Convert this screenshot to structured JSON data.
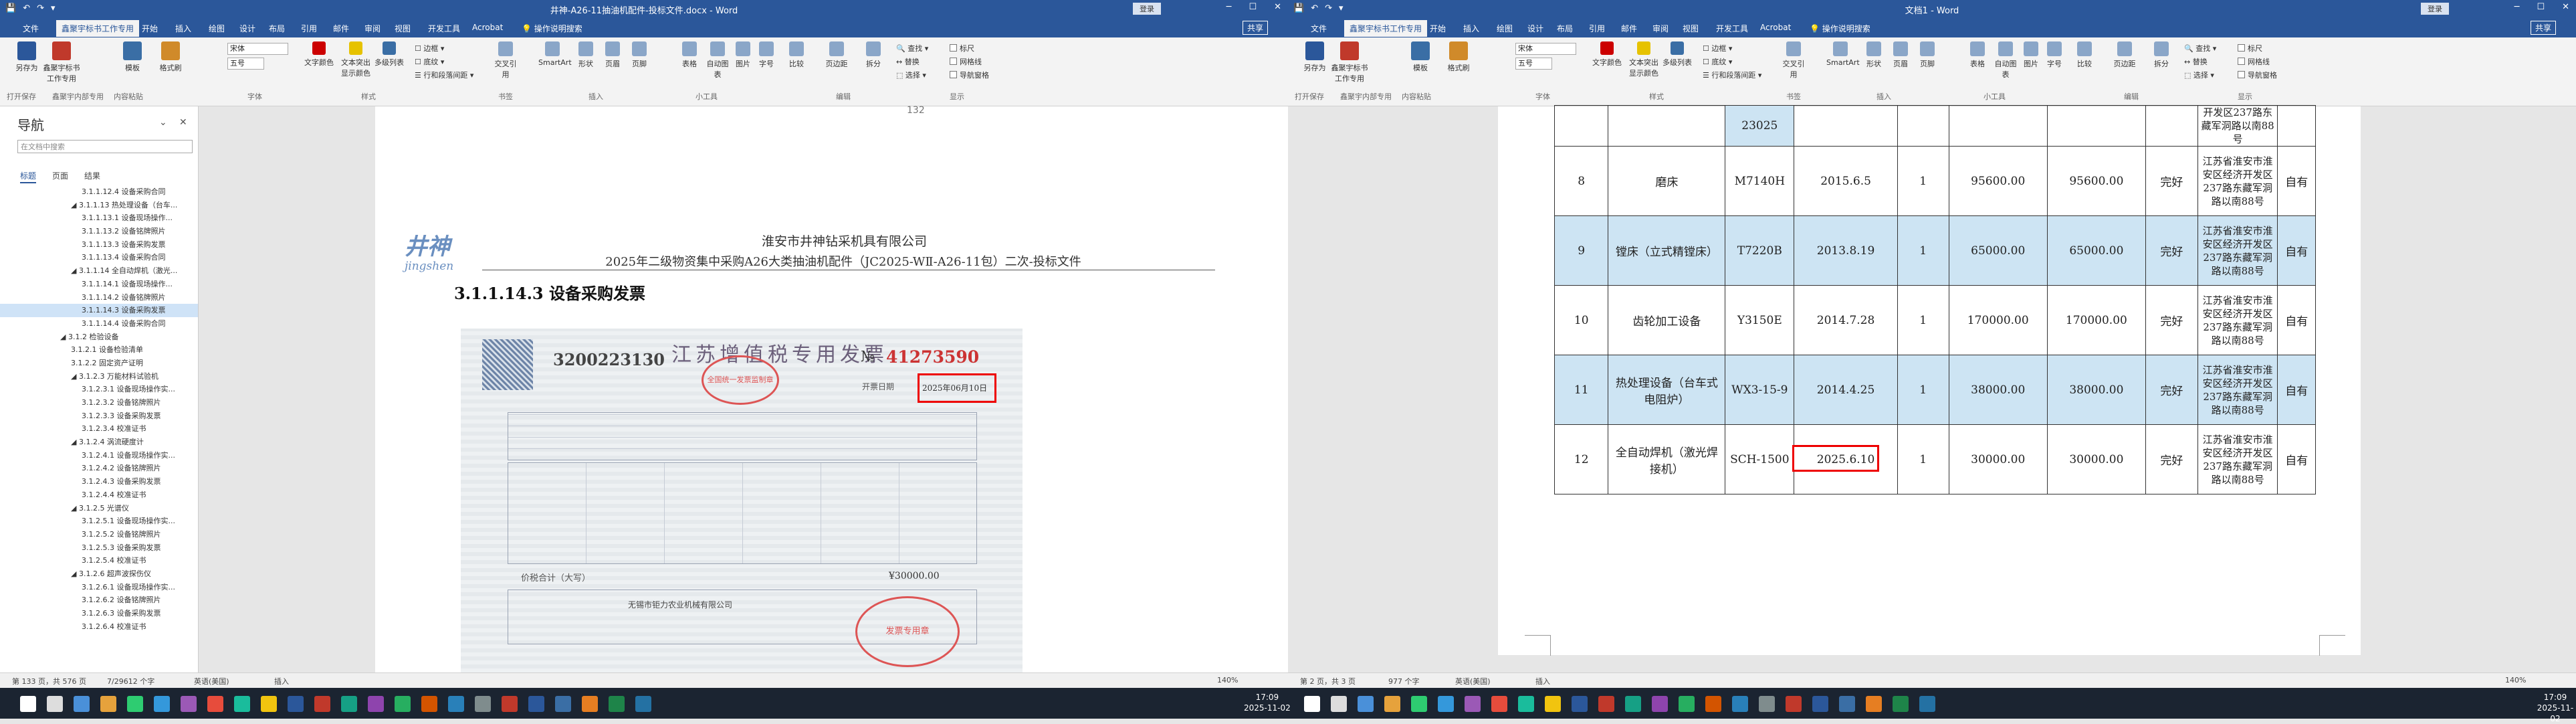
{
  "left_window": {
    "quick_access": [
      "💾",
      "↶",
      "↷",
      "▾"
    ],
    "title": "井神-A26-11抽油机配件-投标文件.docx - Word",
    "login": "登录",
    "tabs": [
      "文件",
      "鑫聚宇标书工作专用",
      "开始",
      "插入",
      "绘图",
      "设计",
      "布局",
      "引用",
      "邮件",
      "审阅",
      "视图",
      "开发工具",
      "Acrobat",
      "💡 操作说明搜索"
    ],
    "share": "共享",
    "ribbon_buttons": [
      "另存为",
      "鑫聚宇标书工作专用",
      "模板",
      "格式刷"
    ],
    "ribbon_groups": [
      "打开保存",
      "鑫聚宇内部专用",
      "内容粘贴",
      "字体",
      "样式",
      "书签",
      "插入",
      "小工具",
      "编辑",
      "显示"
    ],
    "font_name": "宋体",
    "font_size": "五号",
    "style_buttons": [
      "文字颜色",
      "文本突出显示颜色",
      "多级列表"
    ],
    "para_items": [
      "☐ 边框 ▾",
      "☐ 底纹 ▾",
      "☰ 行和段落间距 ▾"
    ],
    "other_buttons": [
      "交叉引用",
      "SmartArt",
      "形状",
      "页眉",
      "页脚",
      "表格",
      "自动图表",
      "图片",
      "字号",
      "比较",
      "页边距",
      "拆分"
    ],
    "edit_items": [
      "🔍 查找 ▾",
      "↔ 替换",
      "⬚ 选择 ▾"
    ],
    "show_checks": [
      "标尺",
      "网格线",
      "导航窗格"
    ],
    "nav": {
      "title": "导航",
      "search_placeholder": "在文档中搜索",
      "tabs": [
        "标题",
        "页面",
        "结果"
      ],
      "items": [
        {
          "indent": 3,
          "text": "3.1.1.12.4 设备采购合同"
        },
        {
          "indent": 2,
          "text": "◢ 3.1.1.13 热处理设备（台车..."
        },
        {
          "indent": 3,
          "text": "3.1.1.13.1 设备现场操作..."
        },
        {
          "indent": 3,
          "text": "3.1.1.13.2 设备铭牌照片"
        },
        {
          "indent": 3,
          "text": "3.1.1.13.3 设备采购发票"
        },
        {
          "indent": 3,
          "text": "3.1.1.13.4 设备采购合同"
        },
        {
          "indent": 2,
          "text": "◢ 3.1.1.14 全自动焊机（激光..."
        },
        {
          "indent": 3,
          "text": "3.1.1.14.1 设备现场操作..."
        },
        {
          "indent": 3,
          "text": "3.1.1.14.2 设备铭牌照片"
        },
        {
          "indent": 3,
          "text": "3.1.1.14.3 设备采购发票",
          "selected": true
        },
        {
          "indent": 3,
          "text": "3.1.1.14.4 设备采购合同"
        },
        {
          "indent": 1,
          "text": "◢ 3.1.2 检验设备"
        },
        {
          "indent": 2,
          "text": "3.1.2.1 设备检验清单"
        },
        {
          "indent": 2,
          "text": "3.1.2.2 固定资产证明"
        },
        {
          "indent": 2,
          "text": "◢ 3.1.2.3 万能材料试验机"
        },
        {
          "indent": 3,
          "text": "3.1.2.3.1 设备现场操作实..."
        },
        {
          "indent": 3,
          "text": "3.1.2.3.2 设备铭牌照片"
        },
        {
          "indent": 3,
          "text": "3.1.2.3.3 设备采购发票"
        },
        {
          "indent": 3,
          "text": "3.1.2.3.4 校准证书"
        },
        {
          "indent": 2,
          "text": "◢ 3.1.2.4 涡流硬度计"
        },
        {
          "indent": 3,
          "text": "3.1.2.4.1 设备现场操作实..."
        },
        {
          "indent": 3,
          "text": "3.1.2.4.2 设备铭牌照片"
        },
        {
          "indent": 3,
          "text": "3.1.2.4.3 设备采购发票"
        },
        {
          "indent": 3,
          "text": "3.1.2.4.4 校准证书"
        },
        {
          "indent": 2,
          "text": "◢ 3.1.2.5 光谱仪"
        },
        {
          "indent": 3,
          "text": "3.1.2.5.1 设备现场操作实..."
        },
        {
          "indent": 3,
          "text": "3.1.2.5.2 设备铭牌照片"
        },
        {
          "indent": 3,
          "text": "3.1.2.5.3 设备采购发票"
        },
        {
          "indent": 3,
          "text": "3.1.2.5.4 校准证书"
        },
        {
          "indent": 2,
          "text": "◢ 3.1.2.6 超声波探伤仪"
        },
        {
          "indent": 3,
          "text": "3.1.2.6.1 设备现场操作实..."
        },
        {
          "indent": 3,
          "text": "3.1.2.6.2 设备铭牌照片"
        },
        {
          "indent": 3,
          "text": "3.1.2.6.3 设备采购发票"
        },
        {
          "indent": 3,
          "text": "3.1.2.6.4 校准证书"
        }
      ]
    },
    "page_number": "132",
    "header_company": "淮安市井神钻采机具有限公司",
    "header_project": "2025年二级物资集中采购A26大类抽油机配件（JC2025-WⅡ-A26-11包）二次-投标文件",
    "logo": "井神",
    "logo_sub": "jingshen",
    "section_heading": "3.1.1.14.3 设备采购发票",
    "invoice": {
      "title": "江苏增值税专用发票",
      "code": "3200223130",
      "number_prefix": "№",
      "number": "41273590",
      "date_label": "开票日期",
      "date": "2025年06月10日",
      "seller": "无锡市钜力农业机械有限公司",
      "total_label": "价税合计（大写）",
      "total": "¥30000.00"
    },
    "status": {
      "page": "第 133 页，共 576 页",
      "words": "7/29612 个字",
      "lang": "英语(美国)",
      "insert": "插入",
      "zoom": "140%"
    }
  },
  "right_window": {
    "quick_access": [
      "💾",
      "↶",
      "↷",
      "▾"
    ],
    "title": "文档1 - Word",
    "login": "登录",
    "tabs": [
      "文件",
      "鑫聚宇标书工作专用",
      "开始",
      "插入",
      "绘图",
      "设计",
      "布局",
      "引用",
      "邮件",
      "审阅",
      "视图",
      "开发工具",
      "Acrobat",
      "💡 操作说明搜索"
    ],
    "share": "共享",
    "table_rows": [
      {
        "no": "",
        "name": "",
        "model": "23025",
        "date": "",
        "qty": "",
        "price": "",
        "total": "",
        "status": "",
        "addr": "开发区237路东藏军洞路以南88号",
        "own": "",
        "partial": true
      },
      {
        "no": "8",
        "name": "磨床",
        "model": "M7140H",
        "date": "2015.6.5",
        "qty": "1",
        "price": "95600.00",
        "total": "95600.00",
        "status": "完好",
        "addr": "江苏省淮安市淮安区经济开发区237路东藏军洞路以南88号",
        "own": "自有",
        "hl": false
      },
      {
        "no": "9",
        "name": "镗床（立式精镗床）",
        "model": "T7220B",
        "date": "2013.8.19",
        "qty": "1",
        "price": "65000.00",
        "total": "65000.00",
        "status": "完好",
        "addr": "江苏省淮安市淮安区经济开发区237路东藏军洞路以南88号",
        "own": "自有",
        "hl": true
      },
      {
        "no": "10",
        "name": "齿轮加工设备",
        "model": "Y3150E",
        "date": "2014.7.28",
        "qty": "1",
        "price": "170000.00",
        "total": "170000.00",
        "status": "完好",
        "addr": "江苏省淮安市淮安区经济开发区237路东藏军洞路以南88号",
        "own": "自有",
        "hl": false
      },
      {
        "no": "11",
        "name": "热处理设备（台车式电阻炉）",
        "model": "WX3-15-9",
        "date": "2014.4.25",
        "qty": "1",
        "price": "38000.00",
        "total": "38000.00",
        "status": "完好",
        "addr": "江苏省淮安市淮安区经济开发区237路东藏军洞路以南88号",
        "own": "自有",
        "hl": true
      },
      {
        "no": "12",
        "name": "全自动焊机（激光焊接机）",
        "model": "SCH-1500",
        "date": "2025.6.10",
        "qty": "1",
        "price": "30000.00",
        "total": "30000.00",
        "status": "完好",
        "addr": "江苏省淮安市淮安区经济开发区237路东藏军洞路以南88号",
        "own": "自有",
        "hl": false
      }
    ],
    "status": {
      "page": "第 2 页，共 3 页",
      "words": "977 个字",
      "lang": "英语(美国)",
      "insert": "插入",
      "zoom": "140%"
    }
  },
  "taskbar": {
    "time": "17:09",
    "date": "2025-11-02",
    "time_r": "17:09",
    "date_r": "2025-11-02"
  },
  "colors": {
    "word_blue": "#2b579a",
    "table_highlight": "#cde4f3",
    "annotation_red": "#e00000"
  }
}
